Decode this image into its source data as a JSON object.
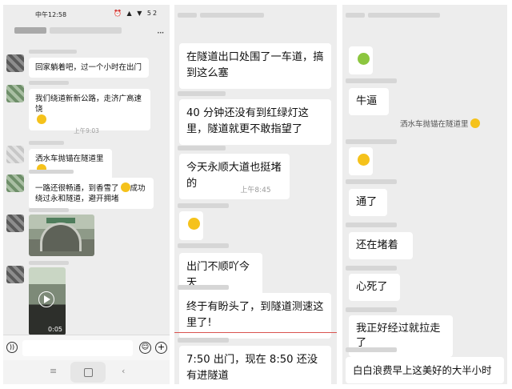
{
  "panel1": {
    "status_time": "中午12:58",
    "status_icons": "⏰ ▲ ▼ 52",
    "more_label": "···",
    "messages": [
      "回家躺着吧，过一个小时在出门",
      "我们绕道新新公路，走济广高速饶",
      "洒水车抛锚在隧道里",
      "一路还很畅通，到香雪了",
      "成功绕过永和隧道，避开拥堵"
    ],
    "timestamp": "上午9:03",
    "video_duration": "0:05",
    "nav": {
      "menu": "≡",
      "back": "‹"
    },
    "input_icons": {
      "voice": "))",
      "emoji": "☺",
      "plus": "+"
    }
  },
  "panel2": {
    "messages": [
      "在隧道出口处围了一车道，搞到这么塞",
      "40 分钟还没有到红绿灯这里，隧道就更不敢指望了",
      "今天永顺大道也挺堵的",
      "出门不顺吖今天",
      "终于有盼头了，到隧道测速这里了!",
      "7:50 出门，现在 8:50 还没有进隧道"
    ],
    "timestamp": "上午8:45"
  },
  "panel3": {
    "messages": [
      "牛逼",
      "洒水车抛锚在隧道里",
      "通了",
      "还在堵着",
      "心死了",
      "我正好经过就拉走了",
      "白白浪费早上这美好的大半小时"
    ]
  }
}
